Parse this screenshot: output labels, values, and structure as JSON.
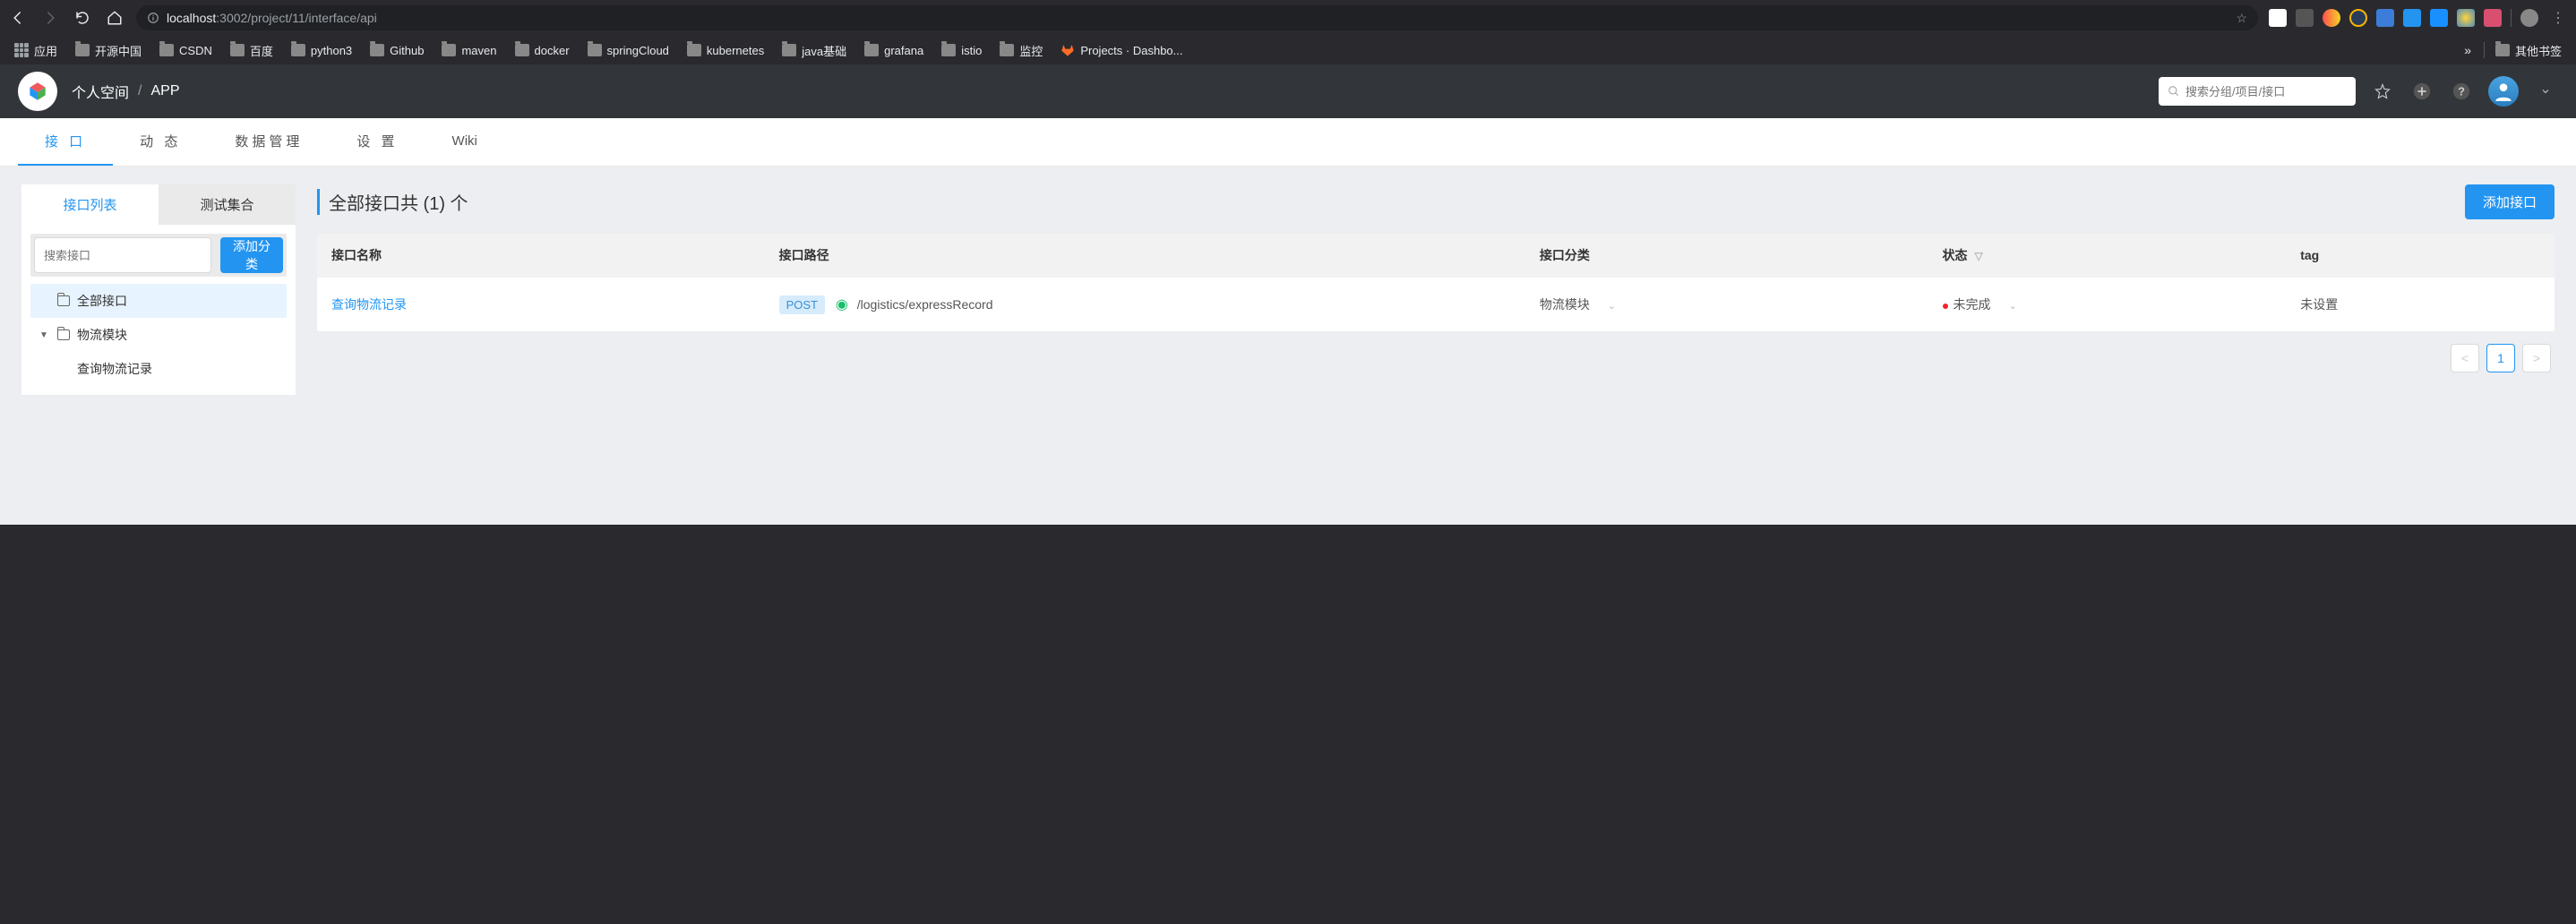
{
  "browser": {
    "url_host": "localhost",
    "url_rest": ":3002/project/11/interface/api",
    "bookmarks": [
      {
        "label": "应用",
        "icon": "apps"
      },
      {
        "label": "开源中国",
        "icon": "folder"
      },
      {
        "label": "CSDN",
        "icon": "folder"
      },
      {
        "label": "百度",
        "icon": "folder"
      },
      {
        "label": "python3",
        "icon": "folder"
      },
      {
        "label": "Github",
        "icon": "folder"
      },
      {
        "label": "maven",
        "icon": "folder"
      },
      {
        "label": "docker",
        "icon": "folder"
      },
      {
        "label": "springCloud",
        "icon": "folder"
      },
      {
        "label": "kubernetes",
        "icon": "folder"
      },
      {
        "label": "java基础",
        "icon": "folder"
      },
      {
        "label": "grafana",
        "icon": "folder"
      },
      {
        "label": "istio",
        "icon": "folder"
      },
      {
        "label": "监控",
        "icon": "folder"
      },
      {
        "label": "Projects · Dashbo...",
        "icon": "gitlab"
      }
    ],
    "other_bookmarks": "其他书签",
    "overflow_chevron": "»"
  },
  "header": {
    "breadcrumb_space": "个人空间",
    "breadcrumb_sep": "/",
    "breadcrumb_app": "APP",
    "search_placeholder": "搜索分组/项目/接口"
  },
  "main_tabs": [
    {
      "label": "接 口",
      "active": true
    },
    {
      "label": "动 态"
    },
    {
      "label": "数据管理"
    },
    {
      "label": "设 置"
    },
    {
      "label": "Wiki",
      "nospace": true
    }
  ],
  "sidebar": {
    "tab_list": "接口列表",
    "tab_test": "测试集合",
    "search_placeholder": "搜索接口",
    "add_category": "添加分类",
    "tree": {
      "all": "全部接口",
      "module": "物流模块",
      "item": "查询物流记录"
    }
  },
  "main": {
    "title": "全部接口共 (1) 个",
    "add_api": "添加接口",
    "columns": {
      "name": "接口名称",
      "path": "接口路径",
      "category": "接口分类",
      "status": "状态",
      "tag": "tag"
    },
    "rows": [
      {
        "name": "查询物流记录",
        "method": "POST",
        "path": "/logistics/expressRecord",
        "category": "物流模块",
        "status": "未完成",
        "tag": "未设置"
      }
    ],
    "pagination": {
      "current": "1"
    }
  }
}
